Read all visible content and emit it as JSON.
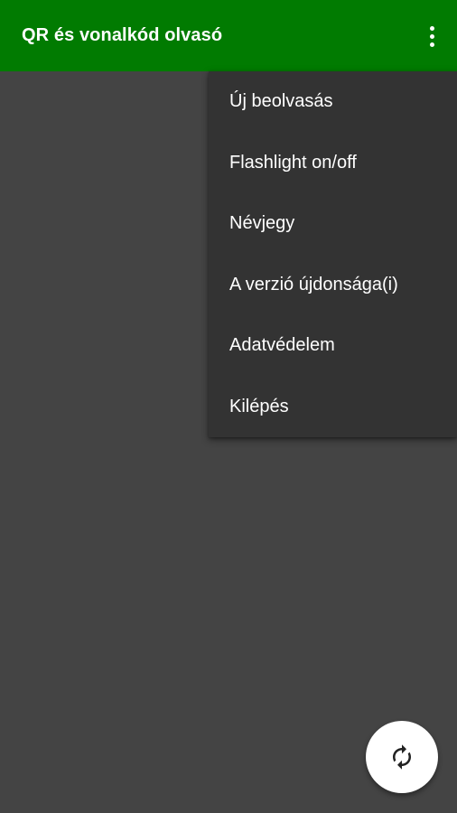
{
  "app": {
    "title": "QR és vonalkód olvasó"
  },
  "colors": {
    "appbar": "#017B01",
    "background": "#444444",
    "menu_background": "#333333",
    "text": "#FFFFFF",
    "fab_background": "#FFFFFF"
  },
  "toolbar": {
    "overflow_icon": "more-vert-icon"
  },
  "menu": {
    "items": [
      {
        "label": "Új beolvasás"
      },
      {
        "label": "Flashlight on/off"
      },
      {
        "label": "Névjegy"
      },
      {
        "label": "A verzió újdonsága(i)"
      },
      {
        "label": "Adatvédelem"
      },
      {
        "label": "Kilépés"
      }
    ]
  },
  "fab": {
    "icon": "switch-camera-icon"
  }
}
